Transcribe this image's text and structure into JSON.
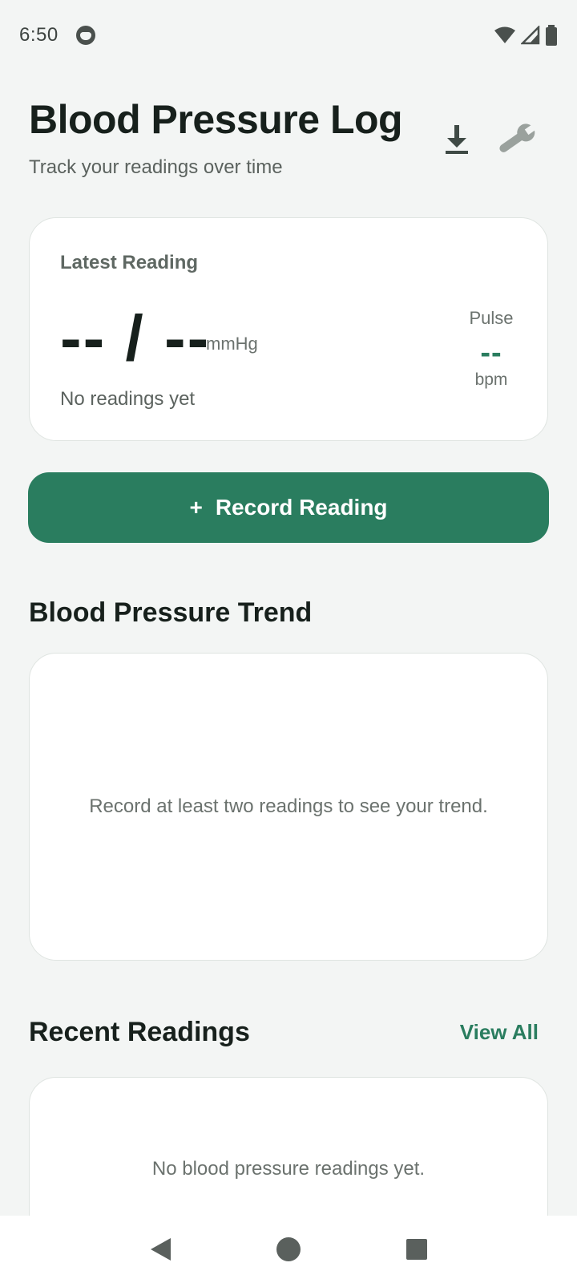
{
  "status_bar": {
    "time": "6:50"
  },
  "header": {
    "title": "Blood Pressure Log",
    "subtitle": "Track your readings over time"
  },
  "latest": {
    "label": "Latest Reading",
    "value": "-- / --",
    "unit": "mmHg",
    "status": "No readings yet",
    "pulse_label": "Pulse",
    "pulse_value": "--",
    "pulse_unit": "bpm"
  },
  "record_button": {
    "icon": "+",
    "label": "Record Reading"
  },
  "trend": {
    "title": "Blood Pressure Trend",
    "empty_message": "Record at least two readings to see your trend."
  },
  "recent": {
    "title": "Recent Readings",
    "view_all": "View All",
    "empty_message": "No blood pressure readings yet."
  },
  "colors": {
    "accent": "#2a7d5f",
    "background": "#f3f5f4",
    "card": "#ffffff"
  },
  "icons": {
    "header": [
      "download-icon",
      "wrench-icon"
    ],
    "status": [
      "face-icon",
      "wifi-icon",
      "signal-icon",
      "battery-icon"
    ],
    "nav": [
      "back-icon",
      "home-icon",
      "recents-icon"
    ]
  }
}
